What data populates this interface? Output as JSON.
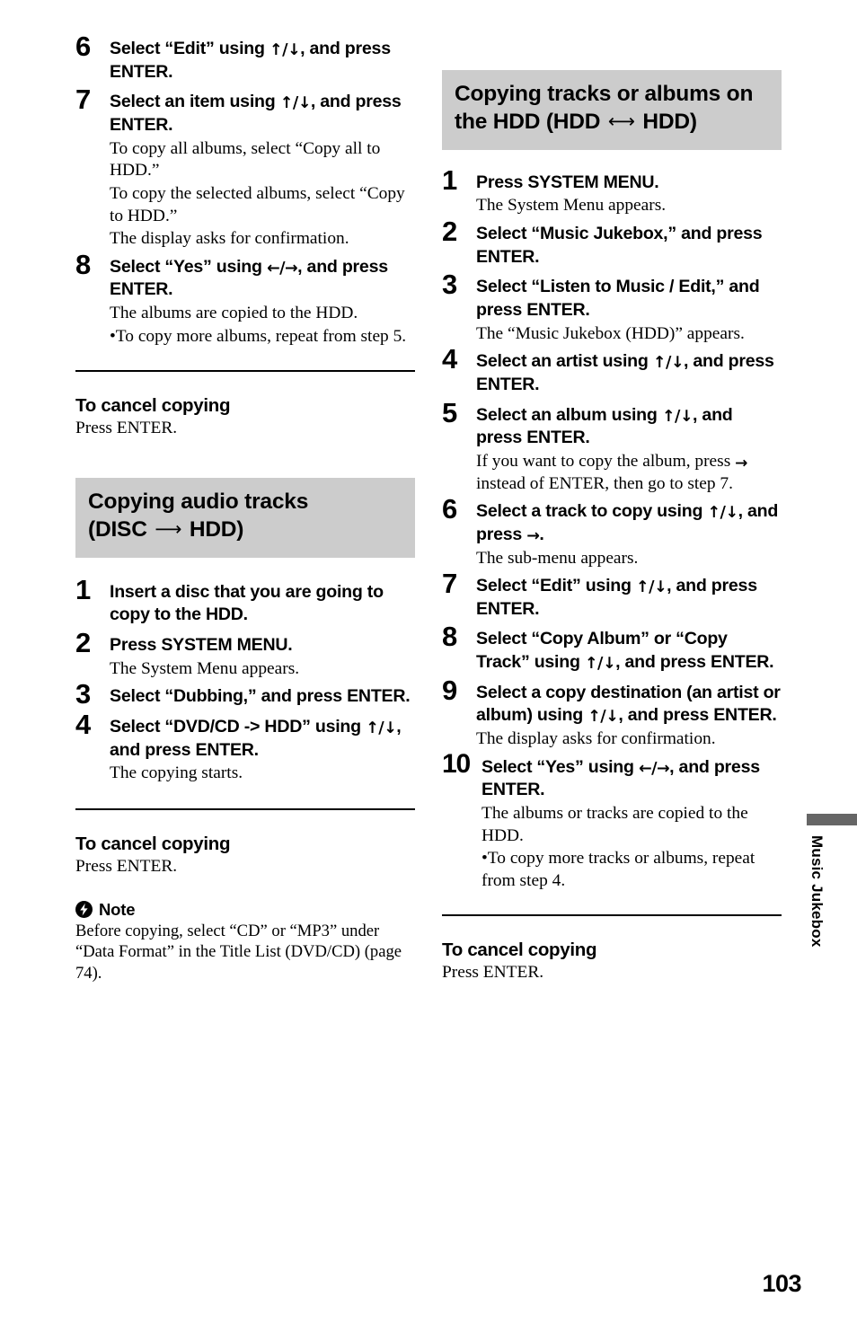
{
  "page": {
    "number": "103",
    "side_tab_label": "Music Jukebox"
  },
  "left_column": {
    "steps_continued": [
      {
        "num": "6",
        "title_pre": "Select “Edit” using ",
        "glyph": "↑/↓",
        "title_post": ", and press ENTER.",
        "body": []
      },
      {
        "num": "7",
        "title_pre": "Select an item using ",
        "glyph": "↑/↓",
        "title_post": ", and press ENTER.",
        "body": [
          "To copy all albums, select “Copy all to HDD.”",
          "To copy the selected albums, select “Copy to HDD.”",
          "The display asks for confirmation."
        ]
      },
      {
        "num": "8",
        "title_pre": "Select “Yes” using ",
        "glyph": "←/→",
        "title_post": ", and press ENTER.",
        "body": [
          "The albums are copied to the HDD."
        ],
        "bullets": [
          "To copy more albums, repeat from step 5."
        ]
      }
    ],
    "cancel_1": {
      "heading": "To cancel copying",
      "body": "Press ENTER."
    },
    "section_heading": {
      "line1": "Copying audio tracks",
      "line2_pre": "(DISC ",
      "line2_arrow": "⟶",
      "line2_post": " HDD)"
    },
    "steps": [
      {
        "num": "1",
        "title_pre": "Insert a disc that you are going to copy to the HDD.",
        "glyph": "",
        "title_post": "",
        "body": []
      },
      {
        "num": "2",
        "title_pre": "Press SYSTEM MENU.",
        "glyph": "",
        "title_post": "",
        "body": [
          "The System Menu appears."
        ]
      },
      {
        "num": "3",
        "title_pre": "Select “Dubbing,” and press ENTER.",
        "glyph": "",
        "title_post": "",
        "body": []
      },
      {
        "num": "4",
        "title_pre": "Select “DVD/CD -> HDD” using ",
        "glyph": "↑/↓",
        "title_post": ", and press ENTER.",
        "body": [
          "The copying starts."
        ]
      }
    ],
    "cancel_2": {
      "heading": "To cancel copying",
      "body": "Press ENTER."
    },
    "note": {
      "icon": "lightning-bolt-icon",
      "label": "Note",
      "body": "Before copying, select “CD” or “MP3” under “Data Format” in the Title List (DVD/CD) (page 74)."
    }
  },
  "right_column": {
    "section_heading": {
      "line1": "Copying tracks or albums on",
      "line2_pre": "the HDD (HDD ",
      "line2_arrow": "⟷",
      "line2_post": " HDD)"
    },
    "steps": [
      {
        "num": "1",
        "title_pre": "Press SYSTEM MENU.",
        "glyph": "",
        "title_post": "",
        "body": [
          "The System Menu appears."
        ]
      },
      {
        "num": "2",
        "title_pre": "Select “Music Jukebox,” and press ENTER.",
        "glyph": "",
        "title_post": "",
        "body": []
      },
      {
        "num": "3",
        "title_pre": "Select “Listen to Music / Edit,” and press ENTER.",
        "glyph": "",
        "title_post": "",
        "body": [
          "The “Music Jukebox (HDD)” appears."
        ]
      },
      {
        "num": "4",
        "title_pre": "Select an artist using ",
        "glyph": "↑/↓",
        "title_post": ", and press ENTER.",
        "body": []
      },
      {
        "num": "5",
        "title_pre": "Select an album using ",
        "glyph": "↑/↓",
        "title_post": ", and press ENTER.",
        "body_pre": "If you want to copy the album, press ",
        "body_glyph": "→",
        "body_post": " instead of ENTER, then go to step 7."
      },
      {
        "num": "6",
        "title_pre": "Select a track to copy using ",
        "glyph": "↑/↓",
        "title_post": ", and press ",
        "title_glyph2": "→",
        "title_end": ".",
        "body": [
          "The sub-menu appears."
        ]
      },
      {
        "num": "7",
        "title_pre": "Select “Edit” using ",
        "glyph": "↑/↓",
        "title_post": ", and press ENTER.",
        "body": []
      },
      {
        "num": "8",
        "title_pre": "Select “Copy Album” or “Copy Track” using ",
        "glyph": "↑/↓",
        "title_post": ", and press ENTER.",
        "body": []
      },
      {
        "num": "9",
        "title_pre": "Select a copy destination (an artist or album) using ",
        "glyph": "↑/↓",
        "title_post": ", and press ENTER.",
        "body": [
          "The display asks for confirmation."
        ]
      },
      {
        "num": "10",
        "title_pre": "Select “Yes” using ",
        "glyph": "←/→",
        "title_post": ", and press ENTER.",
        "body": [
          "The albums or tracks are copied to the HDD."
        ],
        "bullets": [
          "To copy more tracks or albums, repeat from step 4."
        ]
      }
    ],
    "cancel": {
      "heading": "To cancel copying",
      "body": "Press ENTER."
    }
  },
  "colors": {
    "section_heading_bg": "#cccccc",
    "side_tab_bar": "#666666",
    "text": "#000000"
  }
}
